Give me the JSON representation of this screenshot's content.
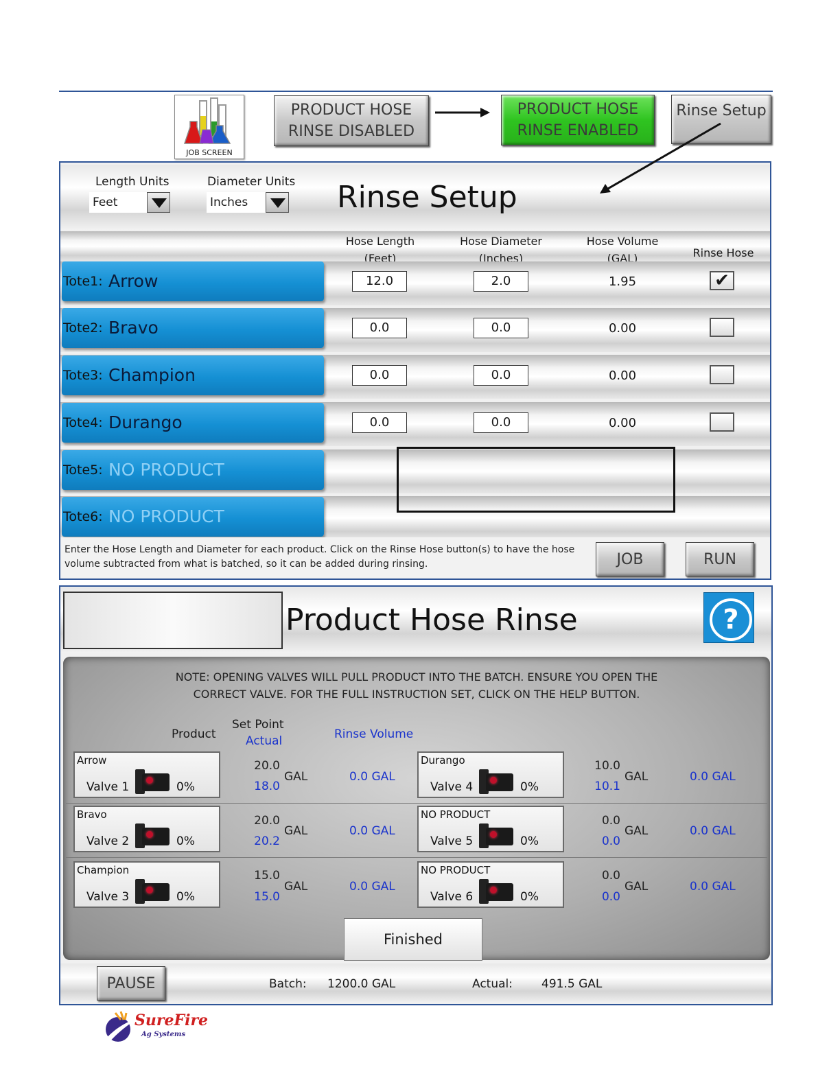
{
  "toolbar": {
    "job_screen_label": "JOB SCREEN",
    "disabled_line1": "PRODUCT HOSE",
    "disabled_line2": "RINSE DISABLED",
    "enabled_line1": "PRODUCT HOSE",
    "enabled_line2": "RINSE ENABLED",
    "rinse_setup_label": "Rinse Setup"
  },
  "rinse_setup": {
    "title": "Rinse Setup",
    "length_units_label": "Length Units",
    "length_units_value": "Feet",
    "diameter_units_label": "Diameter Units",
    "diameter_units_value": "Inches",
    "col_length": [
      "Hose Length",
      "(Feet)"
    ],
    "col_diameter": [
      "Hose Diameter",
      "(Inches)"
    ],
    "col_volume": [
      "Hose Volume",
      "(GAL)"
    ],
    "col_rinse": "Rinse Hose",
    "totes": [
      {
        "num": "Tote1:",
        "name": "Arrow",
        "length": "12.0",
        "diameter": "2.0",
        "volume": "1.95",
        "rinse": "✔"
      },
      {
        "num": "Tote2:",
        "name": "Bravo",
        "length": "0.0",
        "diameter": "0.0",
        "volume": "0.00",
        "rinse": ""
      },
      {
        "num": "Tote3:",
        "name": "Champion",
        "length": "0.0",
        "diameter": "0.0",
        "volume": "0.00",
        "rinse": ""
      },
      {
        "num": "Tote4:",
        "name": "Durango",
        "length": "0.0",
        "diameter": "0.0",
        "volume": "0.00",
        "rinse": ""
      },
      {
        "num": "Tote5:",
        "name": "NO PRODUCT"
      },
      {
        "num": "Tote6:",
        "name": "NO PRODUCT"
      }
    ],
    "instructions_line1": "Enter the Hose Length and Diameter for each product.  Click on the Rinse Hose button(s) to have the hose",
    "instructions_line2": "volume subtracted from what is batched, so it can be added during rinsing.",
    "job_button": "JOB",
    "run_button": "RUN"
  },
  "hose_rinse": {
    "title": "Product Hose Rinse",
    "help_icon": "?",
    "note_line1": "NOTE:  OPENING VALVES WILL PULL PRODUCT INTO THE BATCH.  ENSURE YOU OPEN THE",
    "note_line2": "CORRECT VALVE.  FOR THE FULL INSTRUCTION SET, CLICK ON THE HELP BUTTON.",
    "hdr_product": "Product",
    "hdr_setpoint": "Set Point",
    "hdr_actual": "Actual",
    "hdr_rinse_volume": "Rinse Volume",
    "gal_unit": "GAL",
    "valves": [
      {
        "product": "Arrow",
        "valve": "Valve 1",
        "pct": "0%",
        "setpoint": "20.0",
        "actual": "18.0",
        "rinse": "0.0 GAL"
      },
      {
        "product": "Bravo",
        "valve": "Valve 2",
        "pct": "0%",
        "setpoint": "20.0",
        "actual": "20.2",
        "rinse": "0.0 GAL"
      },
      {
        "product": "Champion",
        "valve": "Valve 3",
        "pct": "0%",
        "setpoint": "15.0",
        "actual": "15.0",
        "rinse": "0.0 GAL"
      },
      {
        "product": "Durango",
        "valve": "Valve 4",
        "pct": "0%",
        "setpoint": "10.0",
        "actual": "10.1",
        "rinse": "0.0 GAL"
      },
      {
        "product": "NO PRODUCT",
        "valve": "Valve 5",
        "pct": "0%",
        "setpoint": "0.0",
        "actual": "0.0",
        "rinse": "0.0 GAL"
      },
      {
        "product": "NO PRODUCT",
        "valve": "Valve 6",
        "pct": "0%",
        "setpoint": "0.0",
        "actual": "0.0",
        "rinse": "0.0 GAL"
      }
    ],
    "finished_button": "Finished",
    "pause_button": "PAUSE",
    "batch_label": "Batch:",
    "batch_value": "1200.0 GAL",
    "actual_label": "Actual:",
    "actual_value": "491.5 GAL"
  },
  "logo": {
    "brand": "SureFire",
    "sub": "Ag Systems"
  },
  "colors": {
    "accent_blue": "#2f5597",
    "tote_blue": "#1590d4",
    "enabled_green": "#2fc420",
    "actual_blue": "#1a33cc",
    "help_blue": "#1a8fd6"
  }
}
